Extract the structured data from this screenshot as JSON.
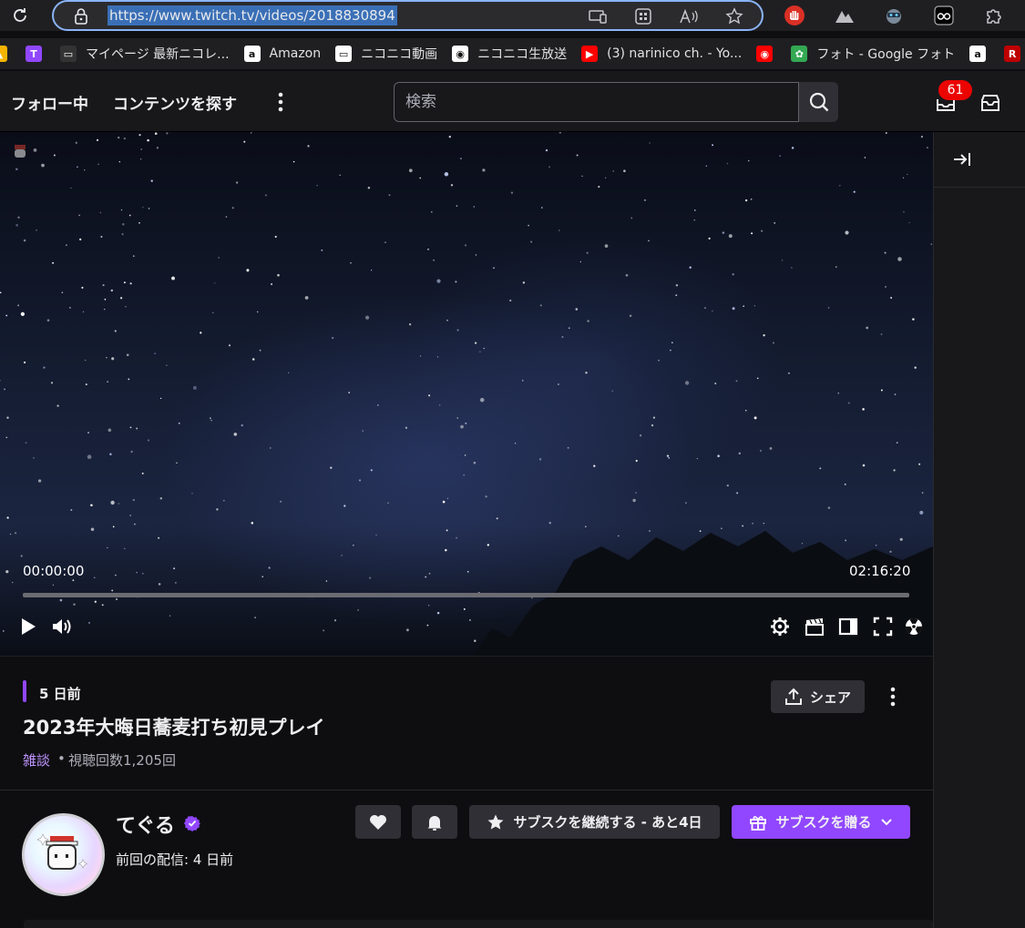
{
  "browser": {
    "url": "https://www.twitch.tv/videos/2018830894"
  },
  "bookmarks": [
    {
      "label": "",
      "icon": "google-drive-icon",
      "color": "#f4b400"
    },
    {
      "label": "",
      "icon": "twitch-icon",
      "color": "#9147ff"
    },
    {
      "label": "マイページ 最新ニコレ...",
      "icon": "niconico-tv-icon",
      "color": "#333333"
    },
    {
      "label": "Amazon",
      "icon": "amazon-icon",
      "color": "#ffffff"
    },
    {
      "label": "ニコニコ動画",
      "icon": "niconico-tv-icon",
      "color": "#ffffff"
    },
    {
      "label": "ニコニコ生放送",
      "icon": "niconico-live-icon",
      "color": "#ffffff"
    },
    {
      "label": "(3) narinico ch. - Yo...",
      "icon": "youtube-icon",
      "color": "#ff0000"
    },
    {
      "label": "",
      "icon": "youtube-music-icon",
      "color": "#ff0000"
    },
    {
      "label": "フォト - Google フォト",
      "icon": "google-photos-icon",
      "color": "#34a853"
    },
    {
      "label": "",
      "icon": "amazon-icon",
      "color": "#ffffff"
    },
    {
      "label": "",
      "icon": "rakuten-icon",
      "color": "#bf0000"
    },
    {
      "label": "",
      "icon": "pixiv-icon",
      "color": "#0096fa"
    }
  ],
  "nav": {
    "following": "フォロー中",
    "browse": "コンテンツを探す",
    "search_placeholder": "検索",
    "notification_count": "61"
  },
  "player": {
    "current_time": "00:00:00",
    "duration": "02:16:20",
    "progress": 0
  },
  "video": {
    "ago": "5 日前",
    "title": "2023年大晦日蕎麦打ち初見プレイ",
    "category": "雑談",
    "separator": "•",
    "views": "視聴回数1,205回",
    "share_label": "シェア"
  },
  "channel": {
    "name": "てぐる",
    "last_live": "前回の配信: 4 日前",
    "resub_label": "サブスクを継続する - あと4日",
    "gift_label": "サブスクを贈る"
  },
  "colors": {
    "accent": "#9147ff",
    "badge": "#eb0400",
    "background": "#0e0e10"
  }
}
